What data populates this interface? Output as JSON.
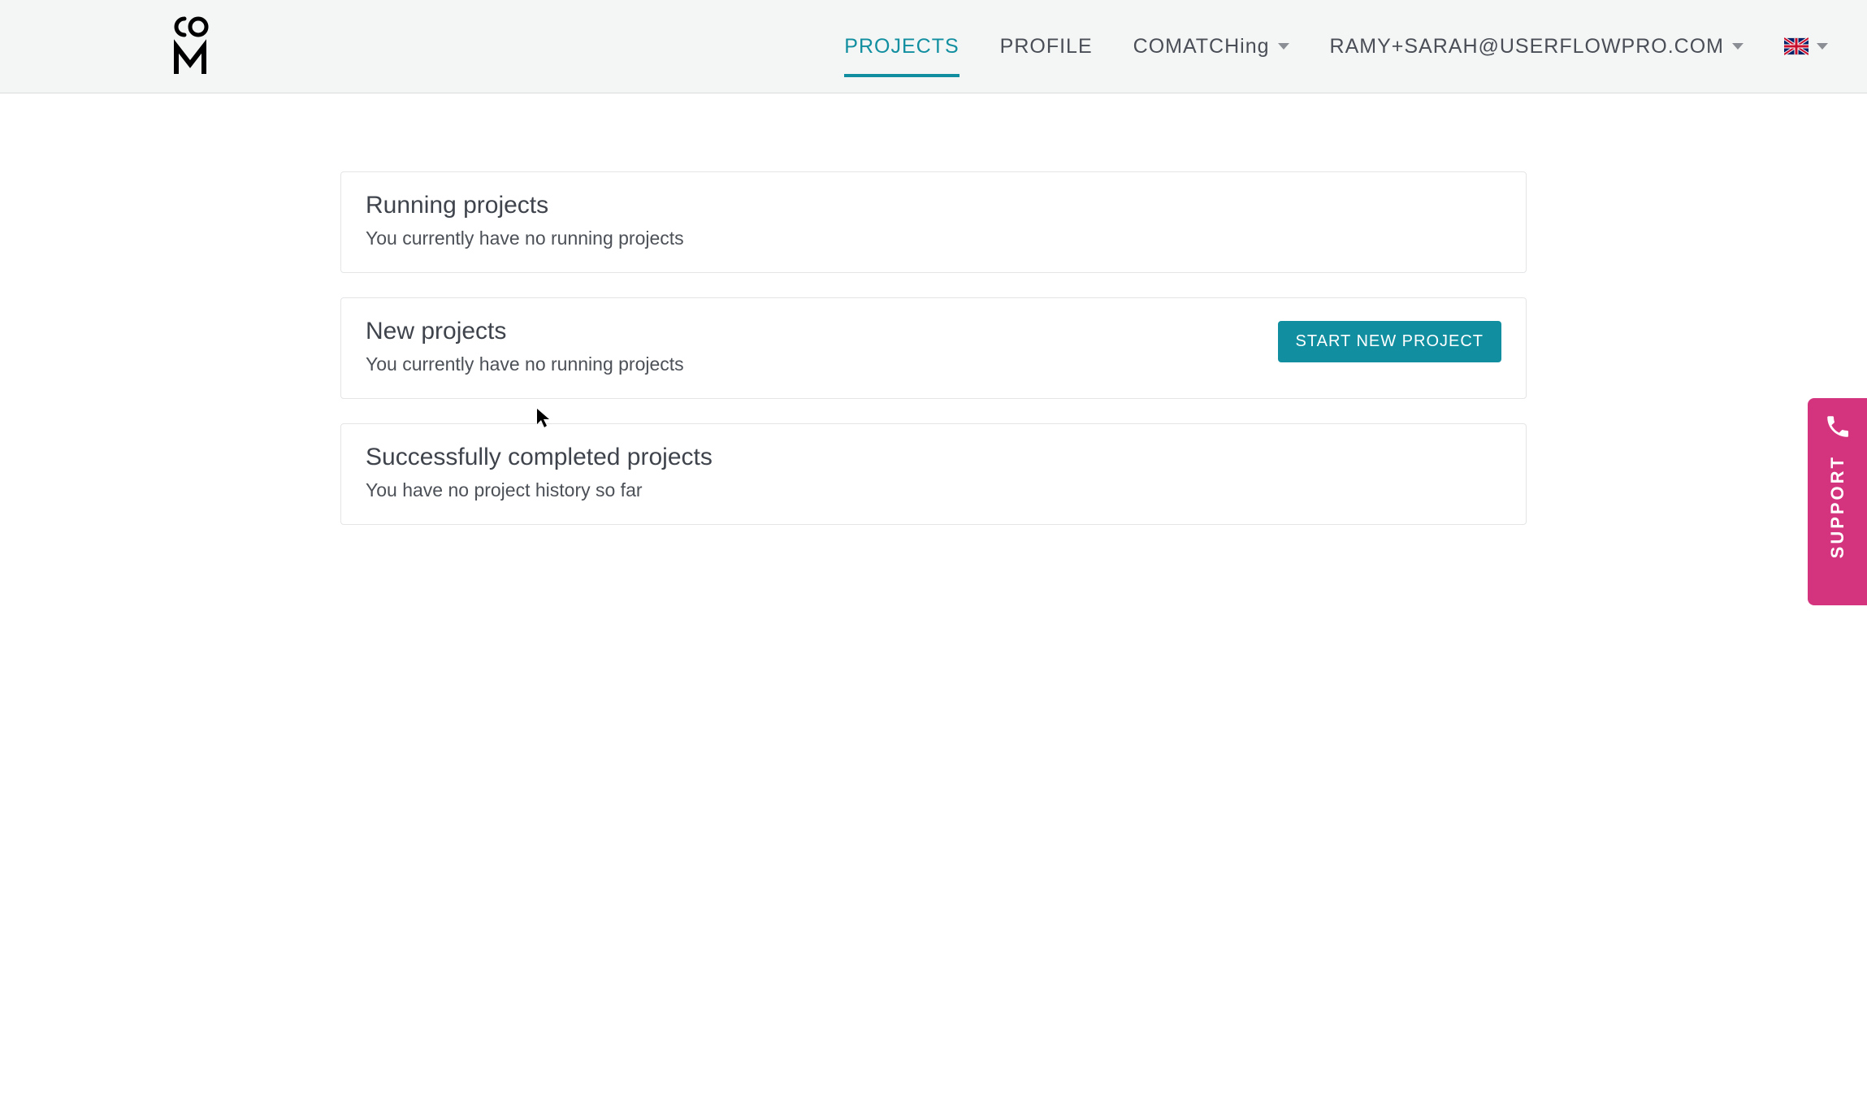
{
  "nav": {
    "projects": "PROJECTS",
    "profile": "PROFILE",
    "comatching": "COMATCHing",
    "user_email": "RAMY+SARAH@USERFLOWPRO.COM"
  },
  "sections": {
    "running": {
      "title": "Running projects",
      "empty": "You currently have no running projects"
    },
    "new": {
      "title": "New projects",
      "empty": "You currently have no running projects",
      "button": "START NEW PROJECT"
    },
    "completed": {
      "title": "Successfully completed projects",
      "empty": "You have no project history so far"
    }
  },
  "support": {
    "label": "SUPPORT"
  }
}
